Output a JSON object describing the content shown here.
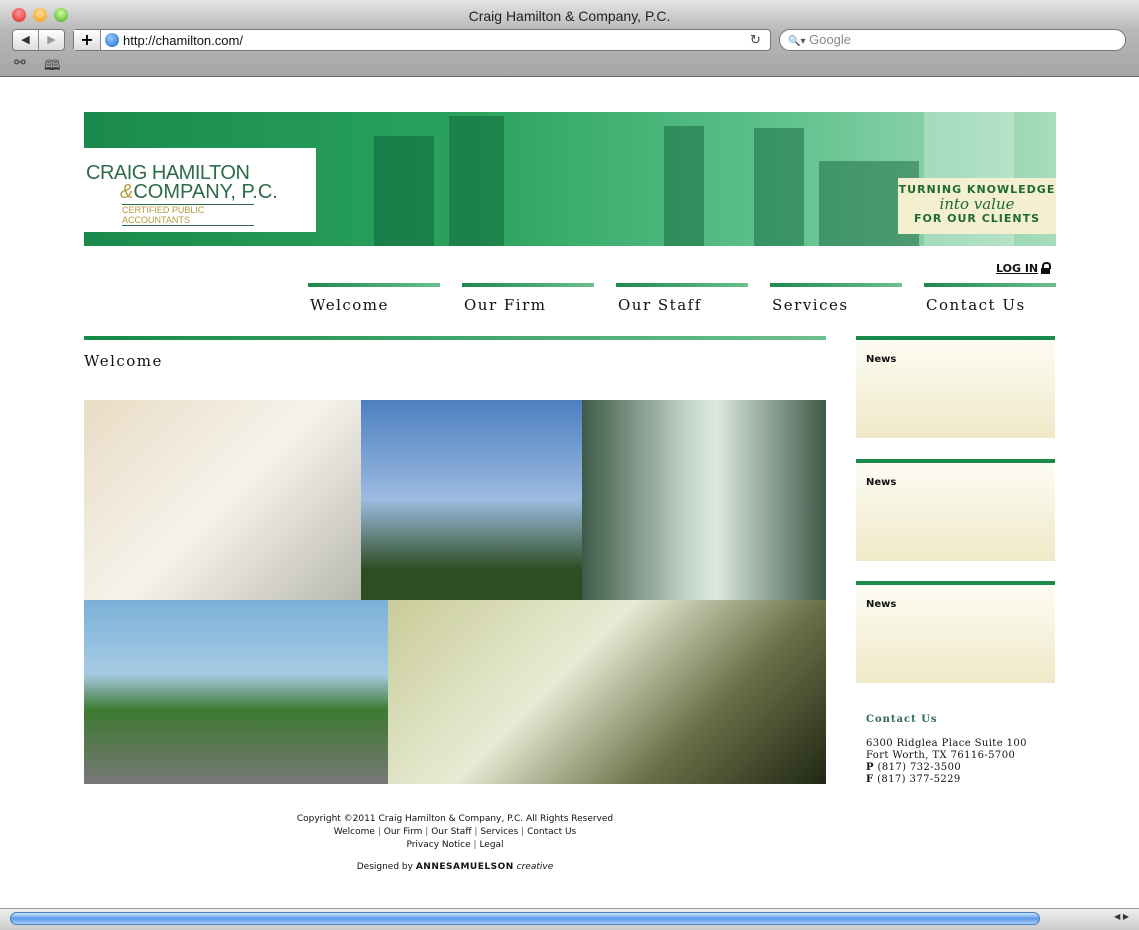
{
  "browser": {
    "title": "Craig Hamilton & Company, P.C.",
    "back": "◀",
    "forward": "▶",
    "add": "+",
    "url": "http://chamilton.com/",
    "reload": "↻",
    "search_placeholder": "Google",
    "search_icon": "🔍▾",
    "reader": "⚯",
    "bookmarks": "🕮"
  },
  "banner": {
    "logo_line1": "CRAIG HAMILTON",
    "logo_amp": "&",
    "logo_line2": "COMPANY, P.C.",
    "logo_line3": "CERTIFIED PUBLIC ACCOUNTANTS",
    "tag1": "TURNING KNOWLEDGE",
    "tag2": "into value",
    "tag3": "FOR OUR CLIENTS"
  },
  "login": "LOG IN",
  "nav": [
    "Welcome",
    "Our Firm",
    "Our Staff",
    "Services",
    "Contact Us"
  ],
  "main": {
    "heading": "Welcome"
  },
  "news": [
    "News",
    "News",
    "News"
  ],
  "contact": {
    "heading": "Contact Us",
    "address1": "6300 Ridglea Place Suite 100",
    "address2": "Fort Worth, TX 76116-5700",
    "p_label": "P",
    "phone": "(817) 732-3500",
    "f_label": "F",
    "fax": "(817) 377-5229"
  },
  "footer": {
    "copyright": "Copyright ©2011 Craig Hamilton & Company, P.C. All Rights Reserved",
    "links": [
      "Welcome",
      "Our Firm",
      "Our Staff",
      "Services",
      "Contact Us"
    ],
    "links2": [
      "Privacy Notice",
      "Legal"
    ],
    "designed_by": "Designed by",
    "designer": "ANNESAMUELSON",
    "designer_suffix": "creative"
  },
  "colors": {
    "accent": "#1e9a50",
    "logo": "#2d6b4a",
    "gold": "#b69a3a"
  }
}
